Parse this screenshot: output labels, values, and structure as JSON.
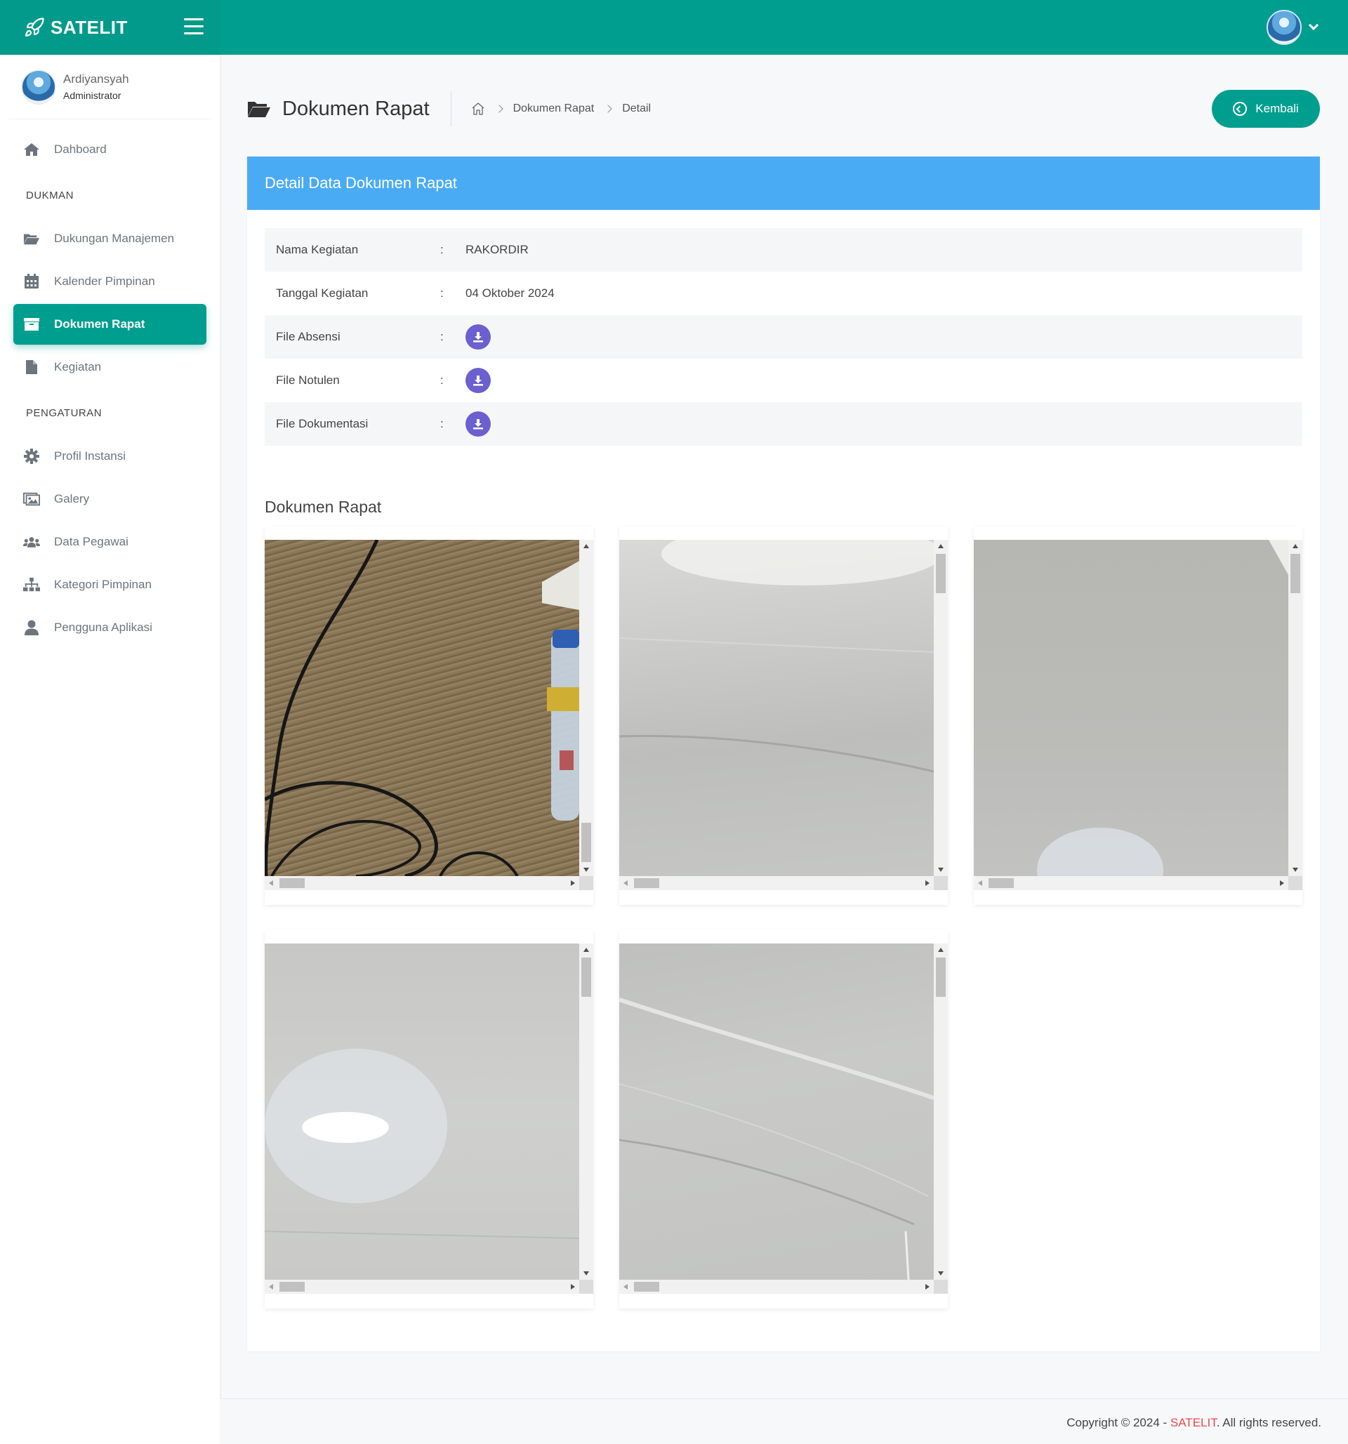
{
  "app": {
    "brand": "SATELIT"
  },
  "user": {
    "name": "Ardiyansyah",
    "role": "Administrator"
  },
  "sidebar": {
    "items": [
      {
        "label": "Dahboard",
        "icon": "home-icon"
      },
      {
        "section": "DUKMAN"
      },
      {
        "label": "Dukungan Manajemen",
        "icon": "folder-open-icon"
      },
      {
        "label": "Kalender Pimpinan",
        "icon": "calendar-icon"
      },
      {
        "label": "Dokumen Rapat",
        "icon": "archive-icon",
        "active": true
      },
      {
        "label": "Kegiatan",
        "icon": "file-icon"
      },
      {
        "section": "PENGATURAN"
      },
      {
        "label": "Profil Instansi",
        "icon": "gear-icon"
      },
      {
        "label": "Galery",
        "icon": "images-icon"
      },
      {
        "label": "Data Pegawai",
        "icon": "users-icon"
      },
      {
        "label": "Kategori Pimpinan",
        "icon": "sitemap-icon"
      },
      {
        "label": "Pengguna Aplikasi",
        "icon": "user-icon"
      }
    ]
  },
  "header": {
    "title": "Dokumen Rapat",
    "breadcrumb": [
      "Dokumen Rapat",
      "Detail"
    ],
    "back_label": "Kembali"
  },
  "card": {
    "title": "Detail Data Dokumen Rapat",
    "rows": [
      {
        "label": "Nama Kegiatan",
        "colon": ":",
        "value": "RAKORDIR"
      },
      {
        "label": "Tanggal Kegiatan",
        "colon": ":",
        "value": "04 Oktober 2024"
      },
      {
        "label": "File Absensi",
        "colon": ":",
        "value": "",
        "download": true
      },
      {
        "label": "File Notulen",
        "colon": ":",
        "value": "",
        "download": true
      },
      {
        "label": "File Dokumentasi",
        "colon": ":",
        "value": "",
        "download": true
      }
    ],
    "section_title": "Dokumen Rapat"
  },
  "footer": {
    "prefix": "Copyright © 2024 - ",
    "brand": "SATELIT",
    "suffix": ". All rights reserved."
  },
  "colors": {
    "primary": "#009e8e",
    "card_header": "#4aabf5",
    "download": "#6c5fcf",
    "footer_brand": "#e8474a"
  }
}
